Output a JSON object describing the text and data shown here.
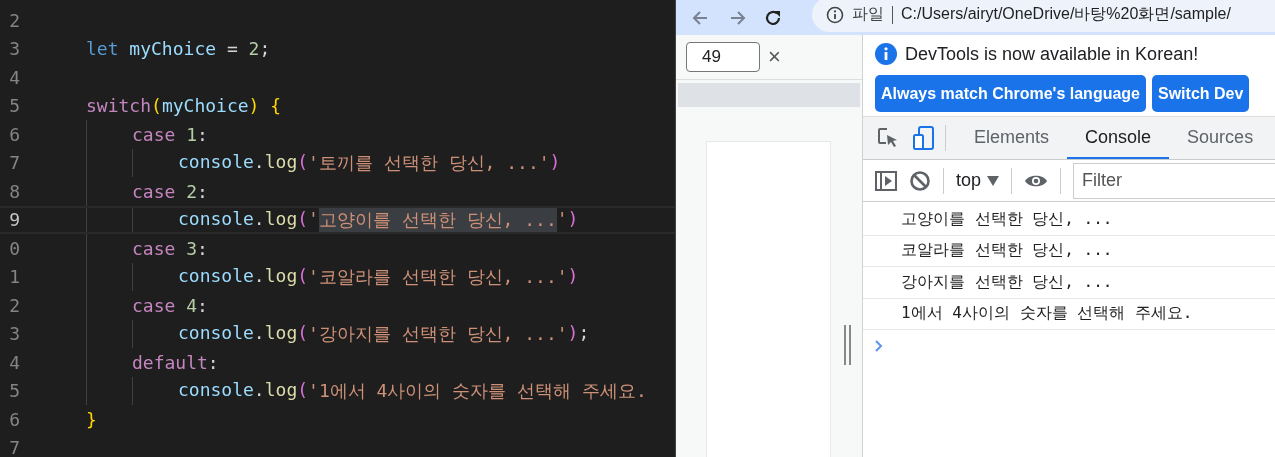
{
  "editor": {
    "lines": [
      {
        "number": "2",
        "current": false
      },
      {
        "number": "3",
        "current": false,
        "tokens": [
          {
            "text": "let ",
            "kind": "keyword"
          },
          {
            "text": "myChoice ",
            "kind": "variable"
          },
          {
            "text": "= ",
            "kind": "operator"
          },
          {
            "text": "2",
            "kind": "number"
          },
          {
            "text": ";",
            "kind": "operator"
          }
        ]
      },
      {
        "number": "4",
        "current": false
      },
      {
        "number": "5",
        "current": false,
        "tokens": [
          {
            "text": "switch",
            "kind": "control"
          },
          {
            "text": "(",
            "kind": "bracket1"
          },
          {
            "text": "myChoice",
            "kind": "variable"
          },
          {
            "text": ")",
            "kind": "bracket1"
          },
          {
            "text": " {",
            "kind": "bracket1"
          }
        ],
        "children": [
          {
            "number": "6",
            "current": false,
            "tokens": [
              {
                "text": "case ",
                "kind": "control"
              },
              {
                "text": "1",
                "kind": "number"
              },
              {
                "text": ":",
                "kind": "operator"
              }
            ],
            "children": [
              {
                "number": "7",
                "current": false,
                "tokens": [
                  {
                    "text": "console",
                    "kind": "variable"
                  },
                  {
                    "text": ".",
                    "kind": "operator"
                  },
                  {
                    "text": "log",
                    "kind": "func"
                  },
                  {
                    "text": "(",
                    "kind": "bracket2"
                  },
                  {
                    "text": "'토끼를 선택한 당신, ...'",
                    "kind": "string"
                  },
                  {
                    "text": ")",
                    "kind": "bracket2"
                  }
                ]
              }
            ]
          },
          {
            "number": "8",
            "current": false,
            "tokens": [
              {
                "text": "case ",
                "kind": "control"
              },
              {
                "text": "2",
                "kind": "number"
              },
              {
                "text": ":",
                "kind": "operator"
              }
            ],
            "children": [
              {
                "number": "9",
                "current": true,
                "tokens": [
                  {
                    "text": "console",
                    "kind": "variable"
                  },
                  {
                    "text": ".",
                    "kind": "operator"
                  },
                  {
                    "text": "log",
                    "kind": "func"
                  },
                  {
                    "text": "(",
                    "kind": "bracket2"
                  },
                  {
                    "text": "'",
                    "kind": "string"
                  },
                  {
                    "text": "고양이를 선택한 당신, ...",
                    "kind": "selection"
                  },
                  {
                    "text": "'",
                    "kind": "string"
                  },
                  {
                    "text": ")",
                    "kind": "bracket2"
                  }
                ]
              }
            ]
          },
          {
            "number": "0",
            "current": false,
            "tokens": [
              {
                "text": "case ",
                "kind": "control"
              },
              {
                "text": "3",
                "kind": "number"
              },
              {
                "text": ":",
                "kind": "operator"
              }
            ],
            "children": [
              {
                "number": "1",
                "current": false,
                "tokens": [
                  {
                    "text": "console",
                    "kind": "variable"
                  },
                  {
                    "text": ".",
                    "kind": "operator"
                  },
                  {
                    "text": "log",
                    "kind": "func"
                  },
                  {
                    "text": "(",
                    "kind": "bracket2"
                  },
                  {
                    "text": "'코알라를 선택한 당신, ...'",
                    "kind": "string"
                  },
                  {
                    "text": ")",
                    "kind": "bracket2"
                  }
                ]
              }
            ]
          },
          {
            "number": "2",
            "current": false,
            "tokens": [
              {
                "text": "case ",
                "kind": "control"
              },
              {
                "text": "4",
                "kind": "number"
              },
              {
                "text": ":",
                "kind": "operator"
              }
            ],
            "children": [
              {
                "number": "3",
                "current": false,
                "tokens": [
                  {
                    "text": "console",
                    "kind": "variable"
                  },
                  {
                    "text": ".",
                    "kind": "operator"
                  },
                  {
                    "text": "log",
                    "kind": "func"
                  },
                  {
                    "text": "(",
                    "kind": "bracket2"
                  },
                  {
                    "text": "'강아지를 선택한 당신, ...'",
                    "kind": "string"
                  },
                  {
                    "text": ")",
                    "kind": "bracket2"
                  },
                  {
                    "text": ";",
                    "kind": "operator"
                  }
                ]
              }
            ]
          },
          {
            "number": "4",
            "current": false,
            "tokens": [
              {
                "text": "default",
                "kind": "control"
              },
              {
                "text": ":",
                "kind": "operator"
              }
            ],
            "children": [
              {
                "number": "5",
                "current": false,
                "tokens": [
                  {
                    "text": "console",
                    "kind": "variable"
                  },
                  {
                    "text": ".",
                    "kind": "operator"
                  },
                  {
                    "text": "log",
                    "kind": "func"
                  },
                  {
                    "text": "(",
                    "kind": "bracket2"
                  },
                  {
                    "text": "'1에서 4사이의 숫자를 선택해 주세요.",
                    "kind": "string"
                  }
                ]
              }
            ]
          }
        ]
      },
      {
        "number": "6",
        "current": false,
        "tokens": [
          {
            "text": "}",
            "kind": "bracket1"
          }
        ]
      },
      {
        "number": "7",
        "current": false
      }
    ]
  },
  "browser": {
    "address": {
      "scheme": "파일",
      "url": "C:/Users/airyt/OneDrive/바탕%20화면/sample/"
    }
  },
  "page": {
    "input_value": "49",
    "close_label": "×"
  },
  "devtools": {
    "infobar": {
      "message": "DevTools is now available in Korean!",
      "buttons": [
        "Always match Chrome's language",
        "Switch Dev"
      ]
    },
    "tabs": [
      {
        "label": "Elements",
        "selected": false
      },
      {
        "label": "Console",
        "selected": true
      },
      {
        "label": "Sources",
        "selected": false
      }
    ],
    "context": "top",
    "filter_placeholder": "Filter",
    "messages": [
      "고양이를 선택한 당신, ...",
      "코알라를 선택한 당신, ...",
      "강아지를 선택한 당신, ...",
      "1에서 4사이의 숫자를 선택해 주세요."
    ]
  }
}
